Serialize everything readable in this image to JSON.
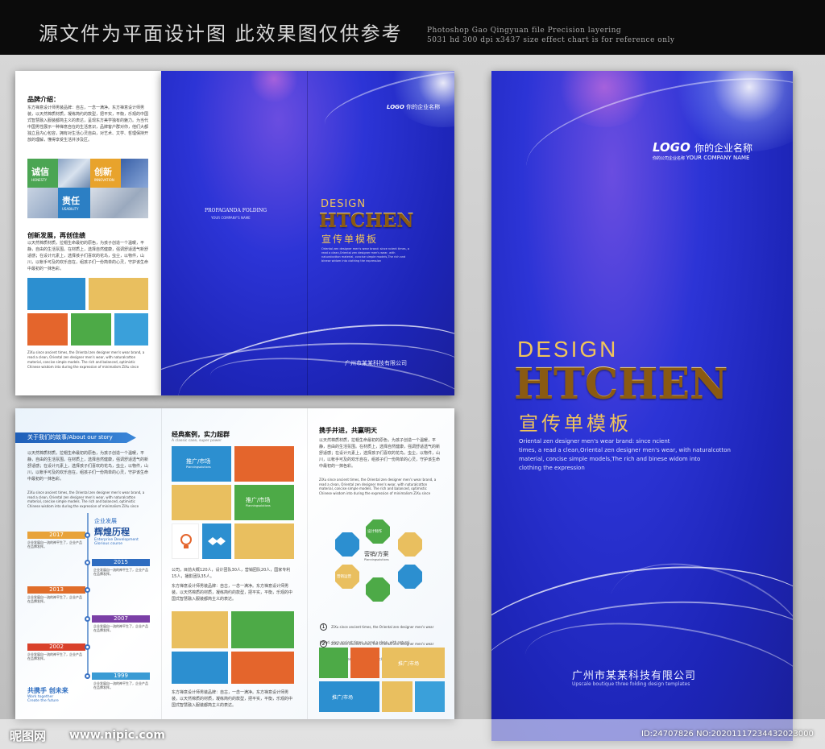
{
  "header": {
    "cn_title": "源文件为平面设计图  此效果图仅供参考",
    "en_line1": "Photoshop Gao Qingyuan file Precision layering",
    "en_line2": "5031 hd 300 dpi x3437 size effect chart is for reference only"
  },
  "left_panel": {
    "brand_title": "品牌介绍：",
    "brand_text": "东方禅意设计师男装品牌：自古，一念一满净。东方禅意设计师男装，以天然棉质材质，凝练简约的款型，把平实，平衡，乐观的中国式智慧融入服装都简主义的表达，呈现东方美学独有的魅力。为当代中国男性展示一种禅意自在的生活意识，品牌客户群对你，他们大都独立且内心包容，拥有对生活心灵自由，对艺术、文学、哲理保持开放的理解，懂得享受生活并涉及区。",
    "tile_labels": {
      "sincere": "诚信",
      "sincere_en": "HONESTY",
      "innovate": "创新",
      "innovate_en": "INNOVATION",
      "duty": "责任",
      "duty_en": "USABILITY"
    },
    "innovate_title": "创新发展，再创佳绩",
    "innovate_text": "以天然棉质材质，拉帽生命最初的原色，为孩子创造一个温暖，平静，自由的生活氛围。在材质上，选择自然健康，强调舒适透气新舒适感；在设计元素上，选择孩子们喜欢的花鸟，虫尘，以物件，山川，以帐手可及的欢乐自在，组孩子们一份简单的心灵，守护该生命中最初的一抹色彩。",
    "en_text": "ZiXu since ancient times, the Oriental zen designer men's wear brand, a read a clean, Oriental zen designer men's wear, with naturalcotton material, concise simple models. The rich and balanced, optimistic Chinese wisdom into during the expression of minimalism ZiXu since"
  },
  "cover_fold": {
    "propaganda": "PROPAGANDA FOLDING",
    "company_name": "YOUR COMPANY'S NAME",
    "logo": "LOGO",
    "logo_cn": "你的企业名称",
    "design": "DESIGN",
    "brand": "HTCHEN",
    "subtitle": "宣传单模板",
    "desc": "Oriental zen designer men's wear brand: since ncient times, a read a clean,Oriental zen designer men's wear, with naturalcotton material, concise simple models,The rich and binese widom into clothing the expression",
    "company_cn": "广州市某某科技有限公司"
  },
  "big_cover": {
    "logo": "LOGO",
    "logo_cn": "你的企业名称",
    "logo_sub": "你的公司企业名称",
    "company_en": "YOUR COMPANY NAME",
    "design": "DESIGN",
    "brand": "HTCHEN",
    "subtitle": "宣传单模板",
    "desc1": "Oriental zen designer men's wear brand: since ncient",
    "desc2": "times, a read a clean,Oriental zen designer men's wear, with naturalcotton",
    "desc3": "material, concise simple models,The rich and binese widom into",
    "desc4": "clothing the expression",
    "company_cn": "广州市某某科技有限公司",
    "company_sub": "Upscale boutique three folding design templates"
  },
  "inner": {
    "story_title": "关于我们的故事/About our story",
    "story_text": "以天然棉质材质，拉帽生命最初的原色，为孩子创造一个温暖，平静，自由的生活氛围。在材质上，选择自然健康，强调舒适透气的新舒适感；在设计元素上，选择孩子们喜欢的花鸟，虫尘，以物件，山川，以帐手可及的欢乐自在，组孩子们一份简单的心灵，守护该生命中最初的一抹色彩。",
    "story_en": "ZiXu since ancient times, the Oriental zen designer men's wear brand, a read a clean, Oriental zen designer men's wear, with naturalcotton material, concise simple models. The rich and balanced, optimistic Chinese wisdom into during the expression of minimalism ZiXu since",
    "timeline_title_small": "企业发展",
    "timeline_title": "辉煌历程",
    "timeline_en1": "Enterprise Development",
    "timeline_en2": "Glorious course",
    "years": [
      "2017",
      "2015",
      "2013",
      "2007",
      "2002",
      "1999"
    ],
    "year_colors": [
      "#e8a33a",
      "#2e6cc0",
      "#e06d2a",
      "#7b3fa6",
      "#d9412b",
      "#3a9bd4"
    ],
    "tl_text": "企业发展自一流的神平生了，企业产品在品牌发挥。",
    "together_title": "共携手 创未来",
    "together_en1": "Work together",
    "together_en2": "Create the future",
    "cases_title": "经典案例，实力超群",
    "cases_en": "A classic case, super power",
    "promo1": "推广/市场",
    "promo1_en": "Planningsolutions",
    "promo2": "推广/市场",
    "promo2_en": "Planningsolutions",
    "cases_text1": "公司，目前大概120人，设计团队30人，营销团队20人，国家专利15人，播影团队35人。",
    "cases_text2": "东方禅意设计师男装品牌：自古，一念一满净。东方禅意设计师男装，以天然棉质的材质，凝练简约的款型，把平实，平衡，乐观的中国式智慧融入服装都简主义的表达。",
    "cases_text3": "东方禅意设计师男装品牌：自古，一念一满净。东方禅意设计师男装，以天然棉质的材质，凝练简约的款型，把平实，平衡，乐观的中国式智慧融入服装都简主义的表达。",
    "hand_title": "携手并进，共赢明天",
    "hand_text": "以天然棉质材质，拉帽生命最初的原色，为孩子创造一个温暖，平静，自由的生活氛围。在材质上，选择自然健康，强调舒适透气的新舒适感；在设计元素上，选择孩子们喜欢的花鸟，虫尘，以物件，山川，以帐手可及的欢乐自在，组孩子们一份简单的心灵，守护该生命中最初的一抹色彩。",
    "hand_en": "ZiXu since ancient times, the Oriental zen designer men's wear brand, a read a clean, Oriental zen designer men's wear, with naturalcotton material, concise simple models. The rich and balanced, optimistic Chinese wisdom into during the expression of minimalism ZiXu since",
    "hex_top": "设计制作",
    "hex_left": "营销运营",
    "hex_center": "营销/方案",
    "hex_center_en": "Planningsolutions",
    "n1": "1",
    "n2": "2",
    "point_text": "ZiXu since ancient times, the Oriental zen designer men's wear brand, since ancient times, a read a clean, with natural",
    "promo3": "推广/市场",
    "promo4": "推广/市场"
  },
  "watermark": {
    "logo": "昵图网",
    "url": "www.nipic.com",
    "id": "ID:24707826 NO:20201117234432023000"
  }
}
